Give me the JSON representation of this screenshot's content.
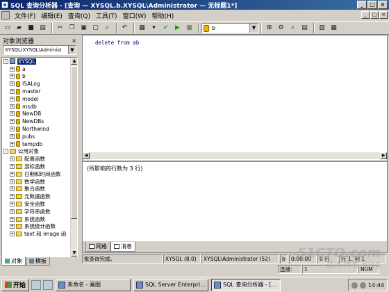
{
  "window": {
    "title": "SQL 查询分析器 - [查询 — XYSQL.b.XYSQL\\Administrator — 无标题1*]",
    "buttons": [
      "_",
      "□",
      "×"
    ]
  },
  "menu": {
    "items": [
      "文件(F)",
      "编辑(E)",
      "查询(Q)",
      "工具(T)",
      "窗口(W)",
      "帮助(H)"
    ],
    "mdi_buttons": [
      "_",
      "□",
      "×"
    ]
  },
  "toolbar": {
    "database": "b"
  },
  "object_browser": {
    "title": "对象浏览器",
    "close": "×",
    "server_combo": "XYSQL(XYSQL\\Administ",
    "tree": [
      {
        "label": "XYSQL",
        "kind": "server",
        "expander": "-",
        "level": 0
      },
      {
        "label": "a",
        "kind": "db",
        "expander": "+",
        "level": 1
      },
      {
        "label": "b",
        "kind": "db",
        "expander": "+",
        "level": 1
      },
      {
        "label": "ISALog",
        "kind": "db",
        "expander": "+",
        "level": 1
      },
      {
        "label": "master",
        "kind": "db",
        "expander": "+",
        "level": 1
      },
      {
        "label": "model",
        "kind": "db",
        "expander": "+",
        "level": 1
      },
      {
        "label": "msdb",
        "kind": "db",
        "expander": "+",
        "level": 1
      },
      {
        "label": "NewDB",
        "kind": "db",
        "expander": "+",
        "level": 1
      },
      {
        "label": "NewDBs",
        "kind": "db",
        "expander": "+",
        "level": 1
      },
      {
        "label": "Northwind",
        "kind": "db",
        "expander": "+",
        "level": 1
      },
      {
        "label": "pubs",
        "kind": "db",
        "expander": "+",
        "level": 1
      },
      {
        "label": "tempdb",
        "kind": "db",
        "expander": "+",
        "level": 1
      },
      {
        "label": "公用对象",
        "kind": "folder",
        "expander": "-",
        "level": 0
      },
      {
        "label": "配置函数",
        "kind": "folder",
        "expander": "+",
        "level": 1
      },
      {
        "label": "游标函数",
        "kind": "folder",
        "expander": "+",
        "level": 1
      },
      {
        "label": "日期和时间函数",
        "kind": "folder",
        "expander": "+",
        "level": 1
      },
      {
        "label": "数学函数",
        "kind": "folder",
        "expander": "+",
        "level": 1
      },
      {
        "label": "聚合函数",
        "kind": "folder",
        "expander": "+",
        "level": 1
      },
      {
        "label": "元数据函数",
        "kind": "folder",
        "expander": "+",
        "level": 1
      },
      {
        "label": "安全函数",
        "kind": "folder",
        "expander": "+",
        "level": 1
      },
      {
        "label": "字符串函数",
        "kind": "folder",
        "expander": "+",
        "level": 1
      },
      {
        "label": "系统函数",
        "kind": "folder",
        "expander": "+",
        "level": 1
      },
      {
        "label": "系统统计函数",
        "kind": "folder",
        "expander": "+",
        "level": 1
      },
      {
        "label": "text 和 image 函",
        "kind": "folder",
        "expander": "+",
        "level": 1
      }
    ],
    "tabs": [
      "对象",
      "模板"
    ]
  },
  "editor": {
    "code": "delete from ab"
  },
  "results": {
    "message": "(所影响的行数为 3 行)",
    "tabs": [
      "网格",
      "消息"
    ]
  },
  "status": {
    "text": "批查询完成。",
    "server": "XYSQL (8.0)",
    "user": "XYSQL\\Administrator (52)",
    "db": "b",
    "time": "0:00:00",
    "rows": "0 行",
    "position": "行 1, 列 1",
    "row2_label": "连接:",
    "row2_value": "1",
    "mode": "NUM"
  },
  "taskbar": {
    "start": "开始",
    "tasks": [
      "未命名 - 画图",
      "SQL Server Enterpri...",
      "SQL 查询分析器 - [..."
    ],
    "clock": "14:44"
  },
  "watermark": {
    "line1": "51CTO.com",
    "line2": "技术博客  Blog"
  }
}
